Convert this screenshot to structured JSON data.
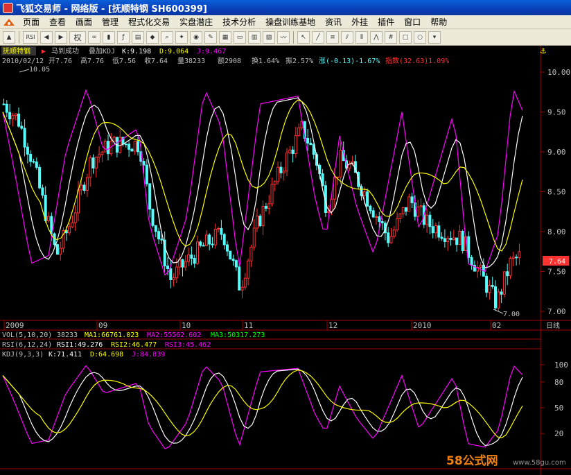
{
  "window": {
    "title": "飞狐交易师 - 网络版 - [抚顺特钢 SH600399]"
  },
  "menu": {
    "items": [
      "页面",
      "查看",
      "画面",
      "管理",
      "程式化交易",
      "实盘潜庄",
      "技术分析",
      "操盘训练基地",
      "资讯",
      "外挂",
      "插件",
      "窗口",
      "帮助"
    ]
  },
  "toolbar": {
    "rsi_label": "RSI",
    "quan_label": "权"
  },
  "main": {
    "stock_name": "抚顺特钢",
    "indicator_name": "马到成功",
    "overlay_label": "叠加KDJ",
    "k": "K:9.198",
    "d": "D:9.064",
    "j": "J:9.467",
    "info": {
      "date": "2010/02/12",
      "open": "开7.76",
      "high": "高7.76",
      "low": "低7.56",
      "close": "收7.64",
      "volume": "量38233",
      "amount": "额2908",
      "turnover": "换1.64%",
      "amplitude": "振2.57%",
      "change": "涨(-0.13)-1.67%",
      "index": "指数(32.63)1.09%"
    },
    "high_mark": "10.05",
    "low_mark": "7.00",
    "current_price": "7.64",
    "price_ticks": [
      "10.00",
      "9.50",
      "9.00",
      "8.50",
      "8.00",
      "7.50",
      "7.00"
    ]
  },
  "date_axis": {
    "labels": [
      "2009",
      "09",
      "10",
      "11",
      "12",
      "2010",
      "02"
    ],
    "period": "日线"
  },
  "vol": {
    "name": "VOL(5,10,20)",
    "value": "38233",
    "ma1": "MA1:66761.023",
    "ma2": "MA2:55562.602",
    "ma3": "MA3:50317.273"
  },
  "rsi": {
    "name": "RSI(6,12,24)",
    "rsi1": "RSI1:49.276",
    "rsi2": "RSI2:46.477",
    "rsi3": "RSI3:45.462"
  },
  "kdj": {
    "name": "KDJ(9,3,3)",
    "k": "K:71.411",
    "d": "D:64.698",
    "j": "J:84.839",
    "ticks": [
      "100",
      "80",
      "50",
      "20"
    ]
  },
  "watermark": {
    "brand": "58公式网",
    "url": "www.58gu.com"
  },
  "colors": {
    "up": "#ff3232",
    "down": "#54fcfc",
    "kdj_k": "#ffffff",
    "kdj_d": "#ffff00",
    "kdj_j": "#ff00ff",
    "axis": "#a00000",
    "text": "#c0c0c0"
  }
}
